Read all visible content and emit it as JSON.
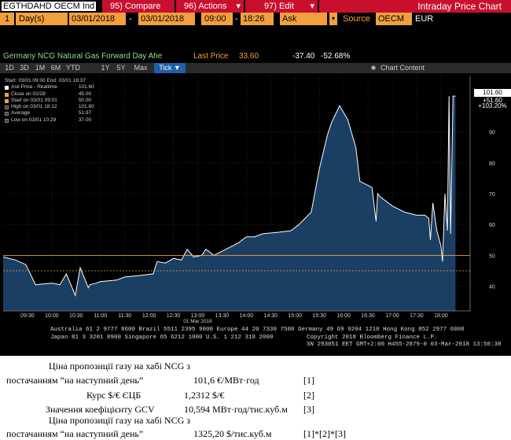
{
  "toolbar": {
    "ticker": "EGTHDAHD OECM Ind",
    "compare_label": "95) Compare",
    "actions_label": "96) Actions",
    "actions_arrow": "▾",
    "edit_label": "97) Edit",
    "edit_arrow": "▾",
    "window_title": "Intraday Price Chart"
  },
  "params": {
    "period_count": "1",
    "period_unit": "Day(s)",
    "start_date": "03/01/2018",
    "date_sep": "-",
    "end_date": "03/01/2018",
    "start_time": "09:00",
    "time_sep": "-",
    "end_time": "18:26",
    "field": "Ask",
    "source_label": "Source",
    "source_value": "OECM",
    "currency": "EUR"
  },
  "status": {
    "security_name": "Germany NCG Natural Gas Forward Day Ahe",
    "last_price_label": "Last Price",
    "last_price": "33.60",
    "change": "-37.40",
    "change_pct": "-52.68%"
  },
  "tabs": [
    {
      "label": "1D"
    },
    {
      "label": "3D"
    },
    {
      "label": "1M"
    },
    {
      "label": "6M"
    },
    {
      "label": "YTD"
    },
    {
      "label": "1Y"
    },
    {
      "label": "5Y"
    },
    {
      "label": "Max"
    },
    {
      "label": "Tick ▼",
      "active": true
    }
  ],
  "chart_content_label": "Chart Content",
  "legend": {
    "header": "Start: 03/01 09:00 End: 03/01 18:37",
    "ask_label": "Ask Price - Realtime",
    "ask_value": "101.60",
    "close_label": "Close on 02/28",
    "close_value": "45.00",
    "start_label": "Start on 03/01 09:01",
    "start_value": "50.00",
    "high_label": "High on 03/01 18:12",
    "high_value": "101.60",
    "avg_label": "Average",
    "avg_value": "51.97",
    "low_label": "Low on 03/01 10:29",
    "low_value": "37.00"
  },
  "price_boxes": {
    "last": "101.60",
    "change": "+51.60",
    "change_pct": "+103.20%"
  },
  "chart_data": {
    "type": "area",
    "title": "",
    "xlabel": "01 Mar 2018",
    "ylabel": "",
    "x_ticks": [
      "09:30",
      "10:00",
      "10:30",
      "11:00",
      "11:30",
      "12:00",
      "12:30",
      "13:00",
      "13:30",
      "14:00",
      "14:30",
      "15:00",
      "15:30",
      "16:00",
      "16:30",
      "17:00",
      "17:30",
      "18:00"
    ],
    "y_ticks": [
      40,
      50,
      60,
      70,
      80,
      90
    ],
    "ylim": [
      32,
      108
    ],
    "xlim_hours": [
      9.0,
      18.6
    ],
    "reference_lines": [
      {
        "label": "Close on 02/28",
        "value": 45.0,
        "color": "#f2a03d"
      },
      {
        "label": "Start on 03/01 09:01",
        "value": 50.0,
        "color": "#f2a03d"
      }
    ],
    "series": [
      {
        "name": "Ask Price - Realtime",
        "x": [
          "09:00",
          "09:15",
          "09:28",
          "09:40",
          "10:00",
          "10:10",
          "10:18",
          "10:29",
          "10:35",
          "10:45",
          "10:47",
          "10:55",
          "11:00",
          "11:20",
          "11:30",
          "11:50",
          "12:05",
          "12:10",
          "12:20",
          "12:30",
          "12:40",
          "12:47",
          "12:55",
          "13:05",
          "13:10",
          "13:20",
          "13:35",
          "13:50",
          "14:00",
          "14:10",
          "14:20",
          "14:40",
          "14:55",
          "15:05",
          "15:20",
          "15:30",
          "15:40",
          "15:45",
          "15:55",
          "16:05",
          "16:15",
          "16:20",
          "16:35",
          "16:40",
          "16:42",
          "16:45",
          "17:00",
          "17:15",
          "17:30",
          "17:40",
          "17:45",
          "17:47",
          "17:50",
          "17:55",
          "18:00",
          "18:02",
          "18:05",
          "18:08",
          "18:10",
          "18:12",
          "18:15",
          "18:18"
        ],
        "y": [
          49.5,
          48.5,
          47.0,
          40.5,
          41.0,
          40.5,
          44.0,
          37.0,
          46.0,
          39.5,
          40.5,
          41.0,
          41.5,
          42.0,
          43.0,
          43.5,
          44.0,
          48.0,
          47.5,
          49.0,
          48.5,
          52.0,
          49.5,
          50.0,
          52.0,
          50.0,
          52.0,
          54.0,
          56.0,
          56.0,
          57.0,
          57.5,
          58.0,
          60.0,
          64.0,
          78.0,
          89.0,
          93.0,
          98.5,
          94.0,
          85.0,
          74.0,
          72.0,
          61.0,
          70.0,
          69.0,
          66.0,
          64.0,
          63.0,
          63.0,
          62.0,
          55.0,
          67.0,
          58.0,
          53.0,
          48.0,
          70.0,
          58.0,
          101.6,
          57.0,
          101.6,
          101.6
        ]
      }
    ]
  },
  "axis_date_label": "01 Mar 2018",
  "footer": {
    "line1": "Australia 61 2 9777 8600  Brazil 5511 2395 9000  Europe 44 20 7330 7500  Germany 49 69 9204 1210  Hong Kong 852 2977 6000",
    "line2": "Japan 81 3 3201 8900        Singapore 65 6212 1000        U.S. 1 212 318 2000",
    "line3": "Copyright 2018 Bloomberg Finance L.P.",
    "line4": "SN 293051 EET  GMT+2:00  H455-2879-0  03-Mar-2018  13:50:38"
  },
  "table": {
    "r1_label_a": "Ціна пропозиції газу на хабі NCG з",
    "r1_label_b": "постачанням “на наступний день”",
    "r1_value": "101,6 €/МВт·год",
    "r1_ref": "[1]",
    "r2_label": "Курс $/€ ЄЦБ",
    "r2_value": "1,2312 $/€",
    "r2_ref": "[2]",
    "r3_label": "Значення коефіцієнту GCV",
    "r3_value": "10,594 МВт·год/тис.куб.м",
    "r3_ref": "[3]",
    "r4_label_a": "Ціна пропозиції газу на хабі NCG з",
    "r4_label_b": "постачанням “на наступний день”",
    "r4_value": "1325,20 $/тис.куб.м",
    "r4_ref": "[1]*[2]*[3]"
  },
  "colors": {
    "accent_red": "#c8102e",
    "amber": "#f2a03d",
    "area_fill": "#1a3f63",
    "line": "#ffffff",
    "tab_active": "#1f5fa8"
  }
}
